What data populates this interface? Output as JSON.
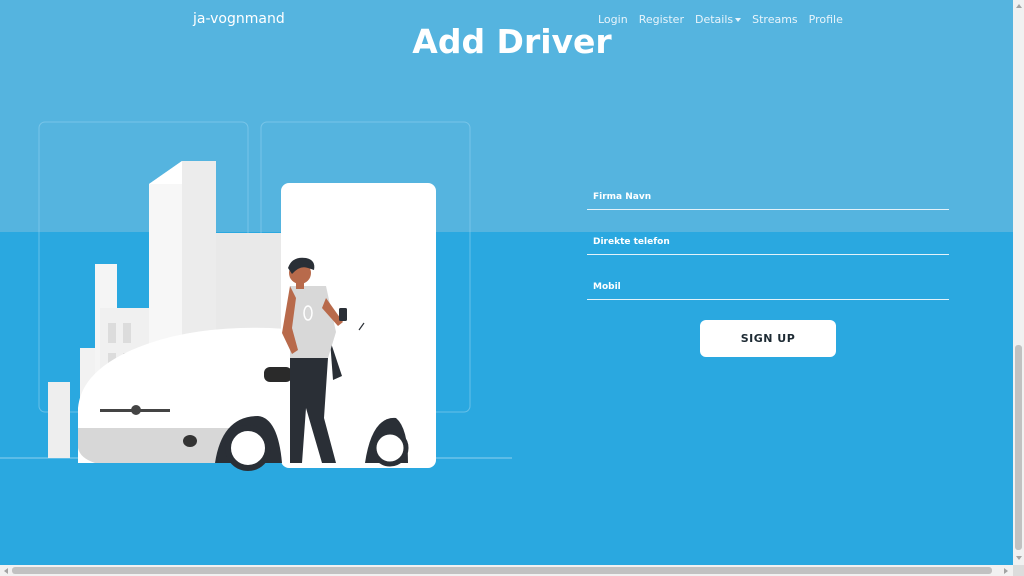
{
  "nav": {
    "brand": "ja-vognmand",
    "links": [
      "Login",
      "Register",
      "Details",
      "Streams",
      "Profile"
    ]
  },
  "page_title": "Add Driver",
  "form": {
    "fields": [
      {
        "label": "Firma Navn"
      },
      {
        "label": "Direkte telefon"
      },
      {
        "label": "Mobil"
      }
    ],
    "submit_label": "SIGN UP"
  },
  "colors": {
    "background": "#2aa8e0",
    "top_band": "#55b4df",
    "button": "#ffffff"
  },
  "illustration": {
    "subject": "person-with-phone-leaning-on-car-icon"
  }
}
